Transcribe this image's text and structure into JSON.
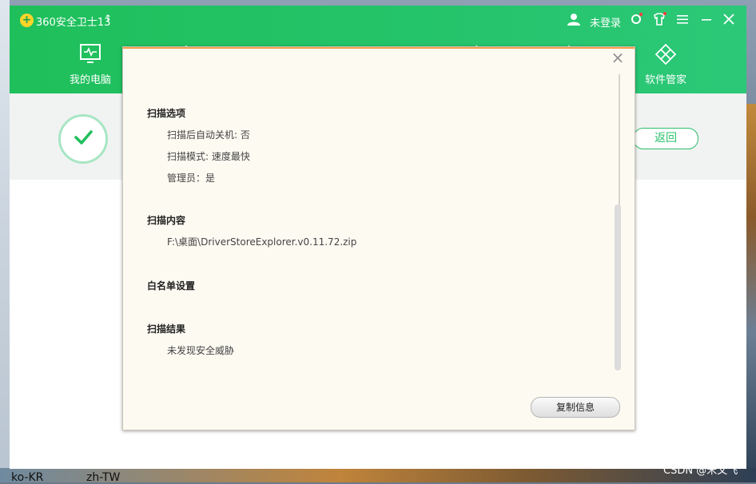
{
  "app": {
    "title": "360安全卫士13",
    "login": "未登录"
  },
  "nav": {
    "my_computer": "我的电脑",
    "software_manager": "软件管家"
  },
  "status": {
    "back_label": "返回"
  },
  "dialog": {
    "sections": [
      {
        "heading": "扫描选项",
        "items": [
          "扫描后自动关机: 否",
          "扫描模式: 速度最快",
          "管理员：是"
        ]
      },
      {
        "heading": "扫描内容",
        "items": [
          "F:\\桌面\\DriverStoreExplorer.v0.11.72.zip"
        ]
      },
      {
        "heading": "白名单设置",
        "items": []
      },
      {
        "heading": "扫描结果",
        "items": [
          "未发现安全威胁"
        ]
      }
    ],
    "copy_label": "复制信息"
  },
  "desktop": {
    "label_ko": "ko-KR",
    "label_zh": "zh-TW",
    "watermark": "CSDN @宋文飞"
  },
  "colors": {
    "brand_green": "#1fbf5b",
    "accent_orange": "#f2a04a"
  }
}
